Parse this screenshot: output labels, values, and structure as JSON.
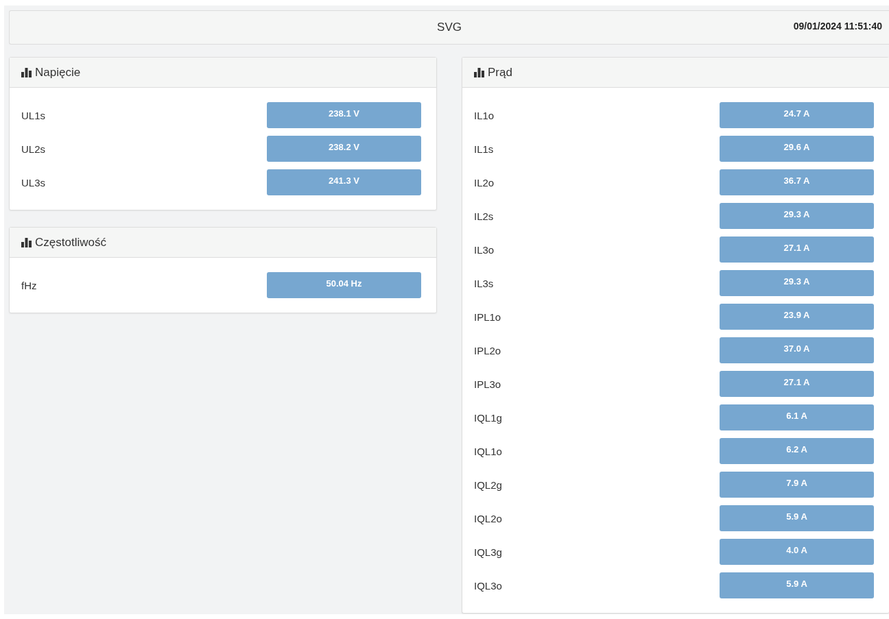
{
  "header": {
    "title": "SVG",
    "datetime": "09/01/2024 11:51:40"
  },
  "columns": [
    {
      "panels": [
        {
          "title": "Napięcie",
          "rows": [
            {
              "label": "UL1s",
              "value": "238.1 V"
            },
            {
              "label": "UL2s",
              "value": "238.2 V"
            },
            {
              "label": "UL3s",
              "value": "241.3 V"
            }
          ]
        },
        {
          "title": "Częstotliwość",
          "rows": [
            {
              "label": "fHz",
              "value": "50.04 Hz"
            }
          ]
        }
      ]
    },
    {
      "panels": [
        {
          "title": "Prąd",
          "rows": [
            {
              "label": "IL1o",
              "value": "24.7 A"
            },
            {
              "label": "IL1s",
              "value": "29.6 A"
            },
            {
              "label": "IL2o",
              "value": "36.7 A"
            },
            {
              "label": "IL2s",
              "value": "29.3 A"
            },
            {
              "label": "IL3o",
              "value": "27.1 A"
            },
            {
              "label": "IL3s",
              "value": "29.3 A"
            },
            {
              "label": "IPL1o",
              "value": "23.9 A"
            },
            {
              "label": "IPL2o",
              "value": "37.0 A"
            },
            {
              "label": "IPL3o",
              "value": "27.1 A"
            },
            {
              "label": "IQL1g",
              "value": "6.1 A"
            },
            {
              "label": "IQL1o",
              "value": "6.2 A"
            },
            {
              "label": "IQL2g",
              "value": "7.9 A"
            },
            {
              "label": "IQL2o",
              "value": "5.9 A"
            },
            {
              "label": "IQL3g",
              "value": "4.0 A"
            },
            {
              "label": "IQL3o",
              "value": "5.9 A"
            }
          ]
        }
      ]
    }
  ]
}
